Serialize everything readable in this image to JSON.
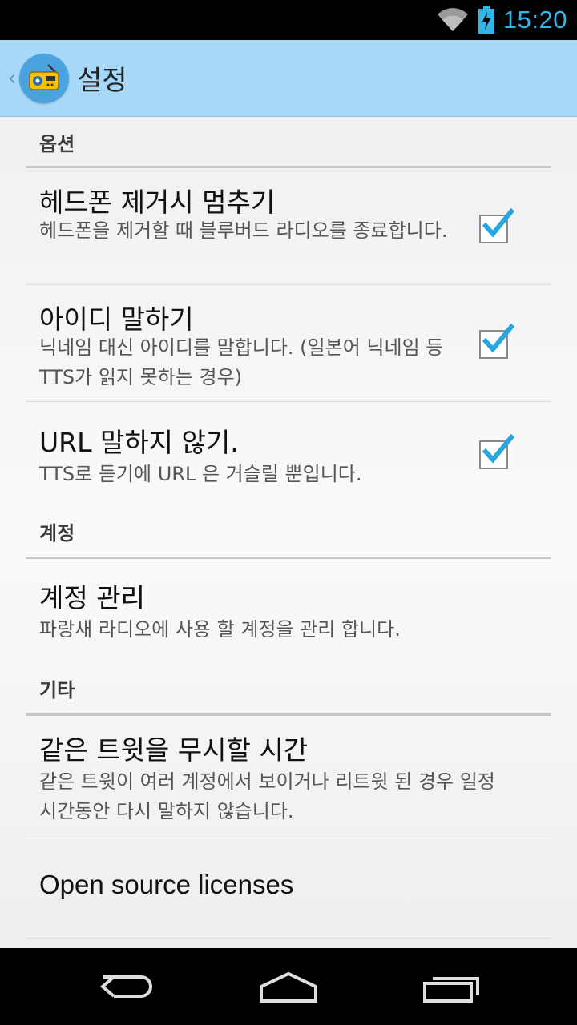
{
  "status_bar": {
    "time": "15:20"
  },
  "action_bar": {
    "title": "설정"
  },
  "categories": [
    {
      "title": "옵션",
      "items": [
        {
          "title": "헤드폰 제거시 멈추기",
          "summary": "헤드폰을 제거할 때 블루버드 라디오를 종료합니다.",
          "checked": true
        },
        {
          "title": "아이디 말하기",
          "summary": "닉네임 대신 아이디를 말합니다. (일본어 닉네임 등 TTS가 읽지 못하는 경우)",
          "checked": true
        },
        {
          "title": "URL 말하지 않기.",
          "summary": "TTS로 듣기에 URL 은 거슬릴 뿐입니다.",
          "checked": true
        }
      ]
    },
    {
      "title": "계정",
      "items": [
        {
          "title": "계정 관리",
          "summary": "파랑새 라디오에 사용 할 계정을 관리 합니다."
        }
      ]
    },
    {
      "title": "기타",
      "items": [
        {
          "title": "같은 트윗을 무시할 시간",
          "summary": "같은 트윗이 여러 계정에서 보이거나 리트윗 된 경우 일정 시간동안 다시 말하지 않습니다."
        },
        {
          "title": "Open source licenses"
        }
      ]
    }
  ],
  "colors": {
    "accent": "#33b5e5",
    "action_bar": "#a7d8f8",
    "checkmark": "#2aa6df"
  },
  "icons": {
    "status": [
      "wifi-icon",
      "battery-charging-icon"
    ],
    "nav": [
      "back-icon",
      "home-icon",
      "recents-icon"
    ]
  }
}
